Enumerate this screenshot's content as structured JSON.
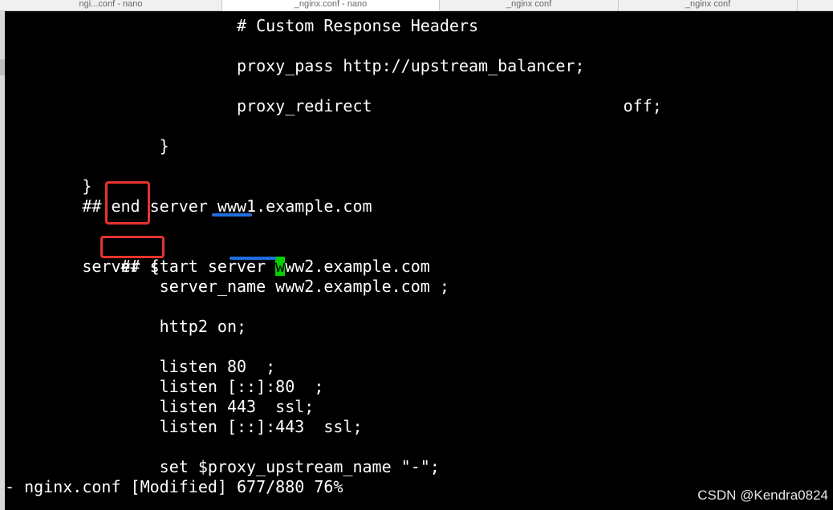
{
  "tabs": [
    {
      "label": "ngi...conf - nano"
    },
    {
      "label": "_nginx.conf - nano"
    },
    {
      "label": "_nginx conf"
    },
    {
      "label": "_nginx conf"
    },
    {
      "label": ""
    }
  ],
  "editor": {
    "lines": [
      "                        # Custom Response Headers",
      "",
      "                        proxy_pass http://upstream_balancer;",
      "",
      "                        proxy_redirect                          off;",
      "",
      "                }",
      "",
      "        }",
      "        ## end server www1.example.com",
      "",
      "        ## start server www2.example.com",
      "        server {",
      "                server_name www2.example.com ;",
      "",
      "                http2 on;",
      "",
      "                listen 80  ;",
      "                listen [::]:80  ;",
      "                listen 443  ssl;",
      "                listen [::]:443  ssl;",
      "",
      "                set $proxy_upstream_name \"-\";"
    ],
    "cursor_line": {
      "before": "        ## start server ",
      "cursor_char": "w",
      "after": "ww2.example.com"
    },
    "status": "- nginx.conf [Modified] 677/880 76%"
  },
  "watermark": "CSDN @Kendra0824",
  "colors": {
    "background": "#000000",
    "text": "#ffffff",
    "cursor": "#00d000",
    "annotation_box": "#e8322d",
    "annotation_underline": "#1f6fe0"
  }
}
